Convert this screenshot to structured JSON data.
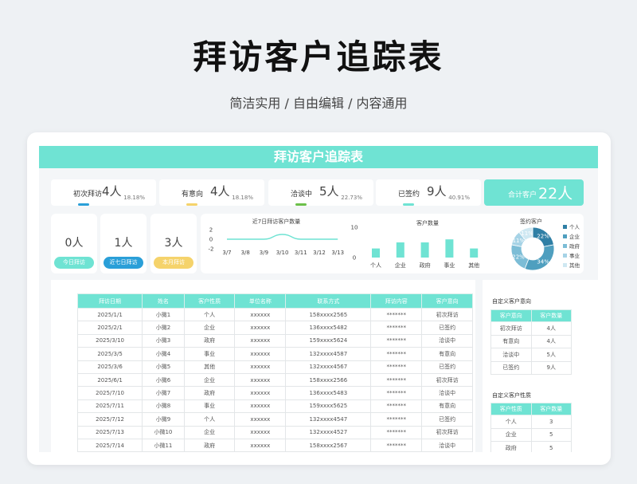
{
  "hero": {
    "title": "拜访客户追踪表",
    "subtitle": "简洁实用 / 自由编辑 / 内容通用"
  },
  "sheet": {
    "banner": "拜访客户追踪表"
  },
  "kpis": [
    {
      "label": "初次拜访",
      "value": "4人",
      "pct": "18.18%",
      "color": "#2a9fd8"
    },
    {
      "label": "有意向",
      "value": "4人",
      "pct": "18.18%",
      "color": "#f5d36b"
    },
    {
      "label": "洽谈中",
      "value": "5人",
      "pct": "22.73%",
      "color": "#6cc04a"
    },
    {
      "label": "已签约",
      "value": "9人",
      "pct": "40.91%",
      "color": "#6fe3d3"
    }
  ],
  "total": {
    "label": "合计客户",
    "value": "22人"
  },
  "boxes": [
    {
      "value": "0人",
      "label": "今日拜访",
      "color": "#6fe3d3"
    },
    {
      "value": "1人",
      "label": "近七日拜访",
      "color": "#2a9fd8"
    },
    {
      "value": "3人",
      "label": "本月拜访",
      "color": "#f5d36b"
    }
  ],
  "colors": {
    "accent": "#6fe3d3"
  },
  "chart_data": [
    {
      "type": "line",
      "title": "近7日拜访客户数量",
      "x": [
        "3/7",
        "3/8",
        "3/9",
        "3/10",
        "3/11",
        "3/12",
        "3/13"
      ],
      "values": [
        0,
        0,
        0,
        1,
        0,
        0,
        0
      ],
      "yticks": [
        "2",
        "0",
        "-2"
      ],
      "ylim": [
        -2,
        2
      ]
    },
    {
      "type": "bar",
      "title": "客户数量",
      "categories": [
        "个人",
        "企业",
        "政府",
        "事业",
        "其他"
      ],
      "values": [
        3,
        5,
        5,
        6,
        3
      ],
      "yticks": [
        "10",
        "0"
      ],
      "ylim": [
        0,
        10
      ]
    },
    {
      "type": "pie",
      "title": "签约客户",
      "legend": [
        "个人",
        "企业",
        "政府",
        "事业",
        "其他"
      ],
      "values": [
        22,
        34,
        22,
        11,
        11
      ],
      "labels": [
        "22%",
        "34%",
        "22%",
        "11%",
        "11%"
      ],
      "colors": [
        "#2f7fa5",
        "#4f9fbf",
        "#7cbdd6",
        "#a6d3e6",
        "#cfe8f2"
      ]
    }
  ],
  "table": {
    "headers": [
      "拜访日期",
      "姓名",
      "客户性质",
      "单位名称",
      "联系方式",
      "拜访内容",
      "客户意向"
    ],
    "rows": [
      [
        "2025/1/1",
        "小微1",
        "个人",
        "xxxxxx",
        "158xxxx2565",
        "*******",
        "初次拜访"
      ],
      [
        "2025/2/1",
        "小微2",
        "企业",
        "xxxxxx",
        "136xxxx5482",
        "*******",
        "已签约"
      ],
      [
        "2025/3/10",
        "小微3",
        "政府",
        "xxxxxx",
        "159xxxx5624",
        "*******",
        "洽谈中"
      ],
      [
        "2025/3/5",
        "小微4",
        "事业",
        "xxxxxx",
        "132xxxx4587",
        "*******",
        "有意向"
      ],
      [
        "2025/3/6",
        "小微5",
        "其他",
        "xxxxxx",
        "132xxxx4567",
        "*******",
        "已签约"
      ],
      [
        "2025/6/1",
        "小微6",
        "企业",
        "xxxxxx",
        "158xxxx2566",
        "*******",
        "初次拜访"
      ],
      [
        "2025/7/10",
        "小微7",
        "政府",
        "xxxxxx",
        "136xxxx5483",
        "*******",
        "洽谈中"
      ],
      [
        "2025/7/11",
        "小微8",
        "事业",
        "xxxxxx",
        "159xxxx5625",
        "*******",
        "有意向"
      ],
      [
        "2025/7/12",
        "小微9",
        "个人",
        "xxxxxx",
        "132xxxx4547",
        "*******",
        "已签约"
      ],
      [
        "2025/7/13",
        "小微10",
        "企业",
        "xxxxxx",
        "132xxxx4527",
        "*******",
        "初次拜访"
      ],
      [
        "2025/7/14",
        "小微11",
        "政府",
        "xxxxxx",
        "158xxxx2567",
        "*******",
        "洽谈中"
      ]
    ]
  },
  "side": {
    "intent_title": "自定义客户意向",
    "intent_headers": [
      "客户意向",
      "客户数量"
    ],
    "intent_rows": [
      [
        "初次拜访",
        "4人"
      ],
      [
        "有意向",
        "4人"
      ],
      [
        "洽谈中",
        "5人"
      ],
      [
        "已签约",
        "9人"
      ]
    ],
    "nature_title": "自定义客户性质",
    "nature_headers": [
      "客户性质",
      "客户数量"
    ],
    "nature_rows": [
      [
        "个人",
        "3"
      ],
      [
        "企业",
        "5"
      ],
      [
        "政府",
        "5"
      ]
    ]
  }
}
